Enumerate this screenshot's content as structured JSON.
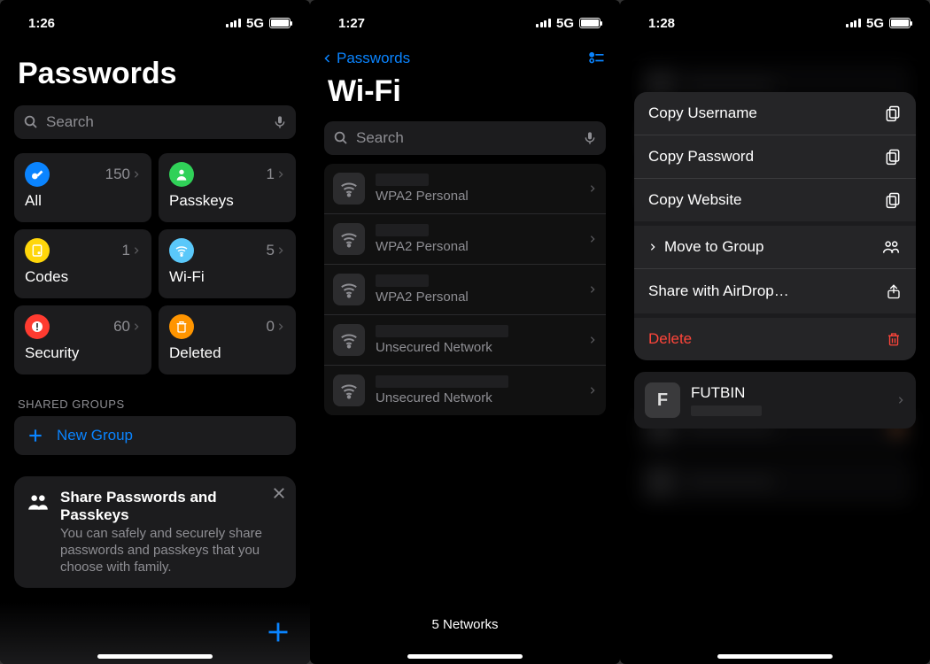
{
  "screen1": {
    "status": {
      "time": "1:26",
      "network": "5G"
    },
    "title": "Passwords",
    "search": {
      "placeholder": "Search"
    },
    "tiles": [
      {
        "id": "all",
        "label": "All",
        "count": 150,
        "color": "c-blue"
      },
      {
        "id": "passkeys",
        "label": "Passkeys",
        "count": 1,
        "color": "c-green"
      },
      {
        "id": "codes",
        "label": "Codes",
        "count": 1,
        "color": "c-gold"
      },
      {
        "id": "wifi",
        "label": "Wi-Fi",
        "count": 5,
        "color": "c-cyan"
      },
      {
        "id": "security",
        "label": "Security",
        "count": 60,
        "color": "c-red"
      },
      {
        "id": "deleted",
        "label": "Deleted",
        "count": 0,
        "color": "c-orange"
      }
    ],
    "shared_header": "SHARED GROUPS",
    "new_group": "New Group",
    "promo": {
      "title": "Share Passwords and Passkeys",
      "body": "You can safely and securely share passwords and passkeys that you choose with family."
    }
  },
  "screen2": {
    "status": {
      "time": "1:27",
      "network": "5G"
    },
    "back": "Passwords",
    "title": "Wi-Fi",
    "search": {
      "placeholder": "Search"
    },
    "networks": [
      {
        "security": "WPA2 Personal",
        "wide": false
      },
      {
        "security": "WPA2 Personal",
        "wide": false
      },
      {
        "security": "WPA2 Personal",
        "wide": false
      },
      {
        "security": "Unsecured Network",
        "wide": true
      },
      {
        "security": "Unsecured Network",
        "wide": true
      }
    ],
    "footer": "5 Networks"
  },
  "screen3": {
    "status": {
      "time": "1:28",
      "network": "5G"
    },
    "menu": {
      "copy_user": "Copy Username",
      "copy_pass": "Copy Password",
      "copy_site": "Copy Website",
      "move": "Move to Group",
      "share": "Share with AirDrop…",
      "delete": "Delete"
    },
    "selected": {
      "letter": "F",
      "title": "FUTBIN"
    }
  }
}
